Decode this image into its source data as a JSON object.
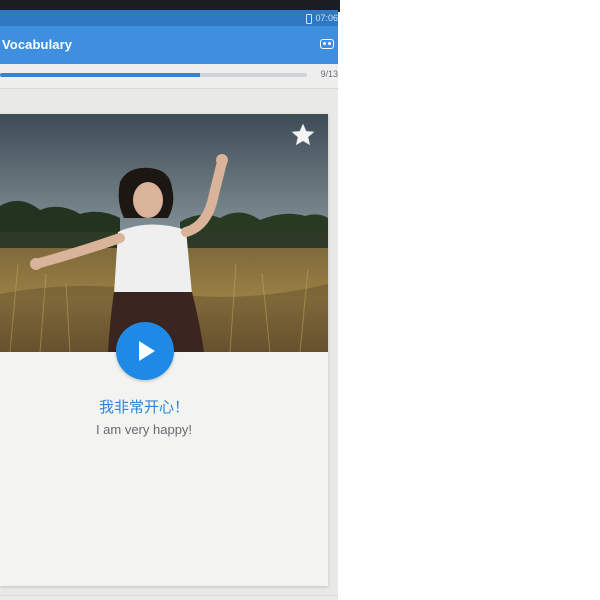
{
  "status_bar": {
    "time": "07:06",
    "battery_icon": "battery-icon"
  },
  "app_bar": {
    "title": "Vocabulary",
    "menu_icon": "flashcard-menu-icon"
  },
  "progress": {
    "current": 9,
    "total": 13,
    "label": "9/13",
    "fraction": 0.65
  },
  "card": {
    "image_icon": "photo",
    "favorite_icon": "star-icon",
    "play_icon": "play-icon",
    "phrase": "我非常开心！",
    "translation": "I am very happy!"
  },
  "colors": {
    "app_bar": "#3e8fe0",
    "status_bar": "#2f78c4",
    "accent": "#1f8ae6",
    "phrase_text": "#2f86d9"
  }
}
